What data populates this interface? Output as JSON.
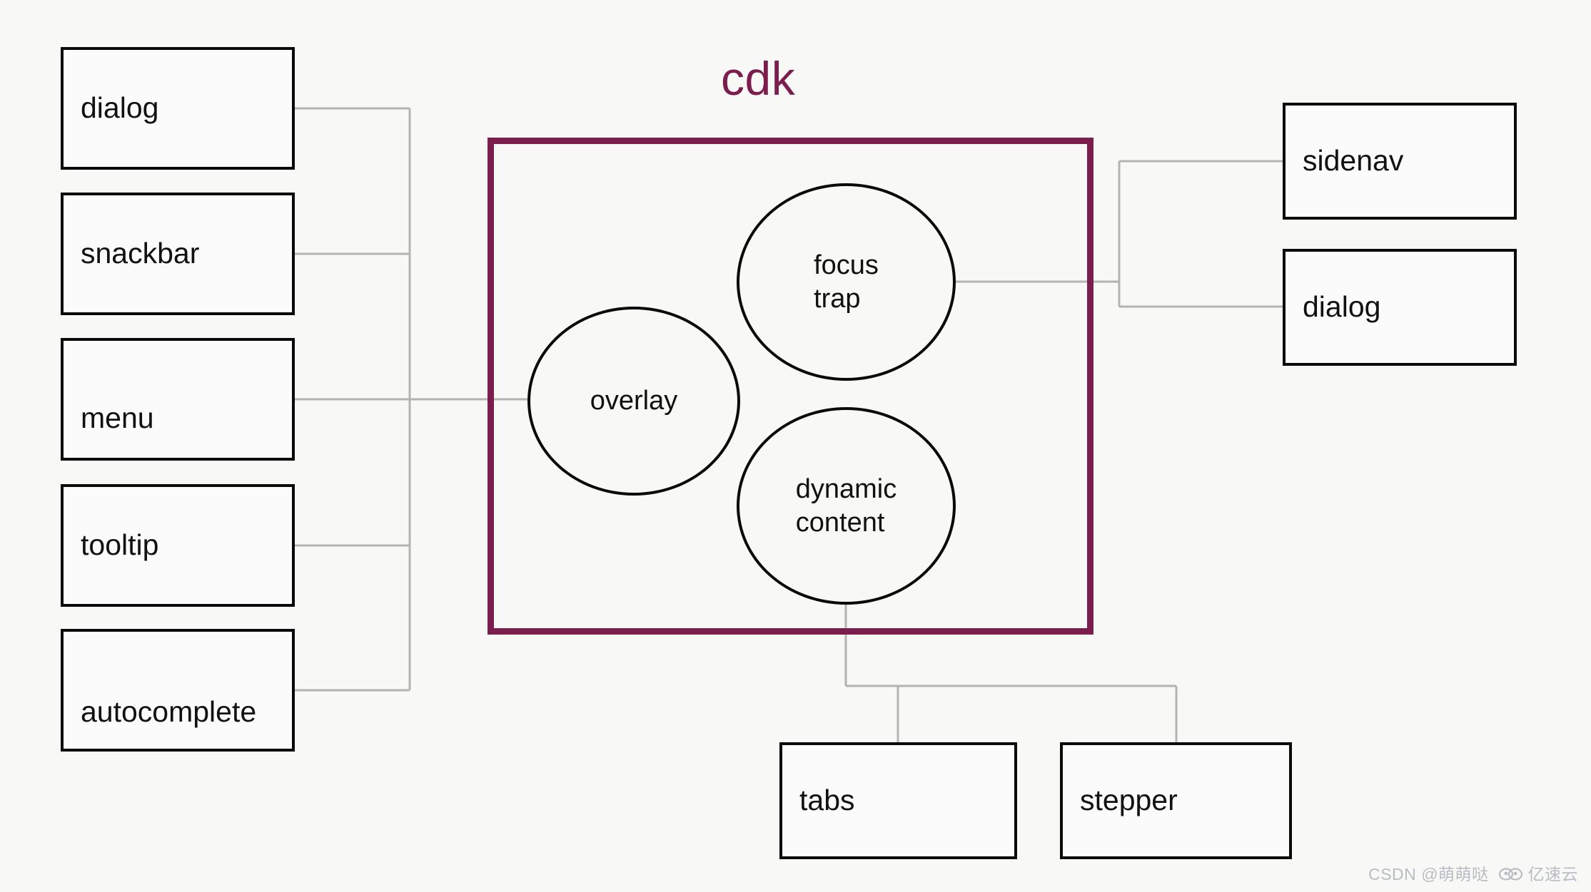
{
  "diagram": {
    "title": "cdk",
    "title_color": "#7b1d4d",
    "container_border_color": "#7b1d4d",
    "node_border_color": "#0a0a0a",
    "connector_color": "#b3b3b3",
    "background_color": "#f8f8f7"
  },
  "left_nodes": [
    {
      "label": "dialog"
    },
    {
      "label": "snackbar"
    },
    {
      "label": "menu"
    },
    {
      "label": "tooltip"
    },
    {
      "label": "autocomplete"
    }
  ],
  "right_nodes": [
    {
      "label": "sidenav"
    },
    {
      "label": "dialog"
    }
  ],
  "bottom_nodes": [
    {
      "label": "tabs"
    },
    {
      "label": "stepper"
    }
  ],
  "circles": [
    {
      "label": "overlay"
    },
    {
      "label": "focus\ntrap"
    },
    {
      "label": "dynamic\ncontent"
    }
  ],
  "watermark": {
    "csdn": "CSDN @萌萌哒",
    "brand": "亿速云"
  }
}
